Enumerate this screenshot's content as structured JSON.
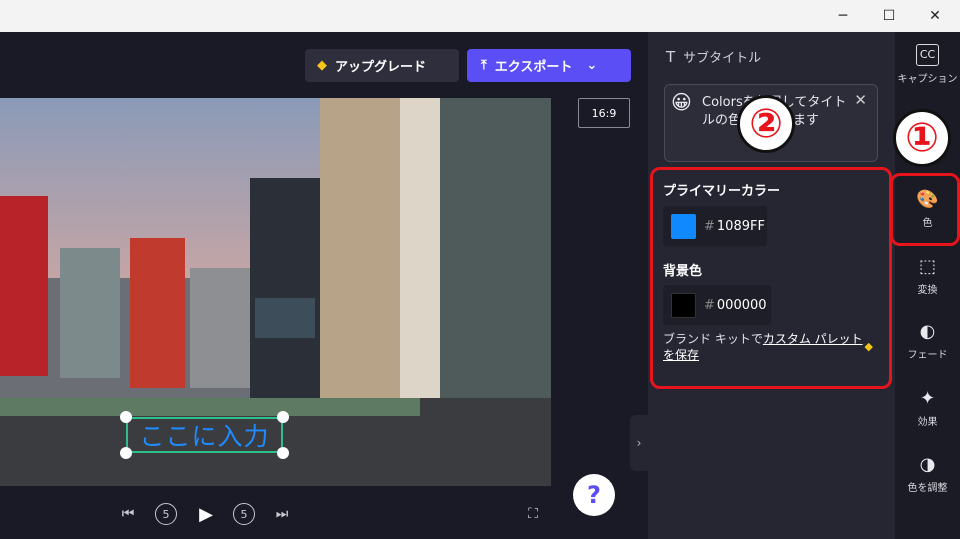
{
  "window": {
    "minimize": "─",
    "maximize": "☐",
    "close": "✕"
  },
  "toolbar": {
    "upgrade_label": "アップグレード",
    "export_label": "エクスポート",
    "aspect_ratio": "16:9"
  },
  "video": {
    "caption_text": "ここに入力"
  },
  "playback": {
    "prev": "⏮",
    "back5": "5",
    "play": "▶",
    "fwd5": "5",
    "next": "⏭",
    "fullscreen": "⛶",
    "help": "?"
  },
  "panel": {
    "title": "サブタイトル",
    "tip_text": "Colorsを使用してタイトルの色を調整します",
    "primary_color_label": "プライマリーカラー",
    "primary_color_hex": "1089FF",
    "primary_color": "#1089FF",
    "background_color_label": "背景色",
    "background_color_hex": "000000",
    "background_color": "#000000",
    "brand_prefix": "ブランド キットで",
    "brand_link": "カスタム パレットを保存"
  },
  "annotations": {
    "badge1": "①",
    "badge2": "②"
  },
  "rail": {
    "captions": "キャプション",
    "color": "色",
    "transform": "変換",
    "fade": "フェード",
    "effects": "効果",
    "adjust": "色を調整"
  },
  "icons": {
    "upgrade": "diamond-icon",
    "export": "upload-icon",
    "captions": "cc-icon",
    "color": "palette-icon",
    "transform": "transform-icon",
    "fade": "fade-icon",
    "effects": "magic-wand-icon",
    "adjust": "contrast-icon"
  }
}
